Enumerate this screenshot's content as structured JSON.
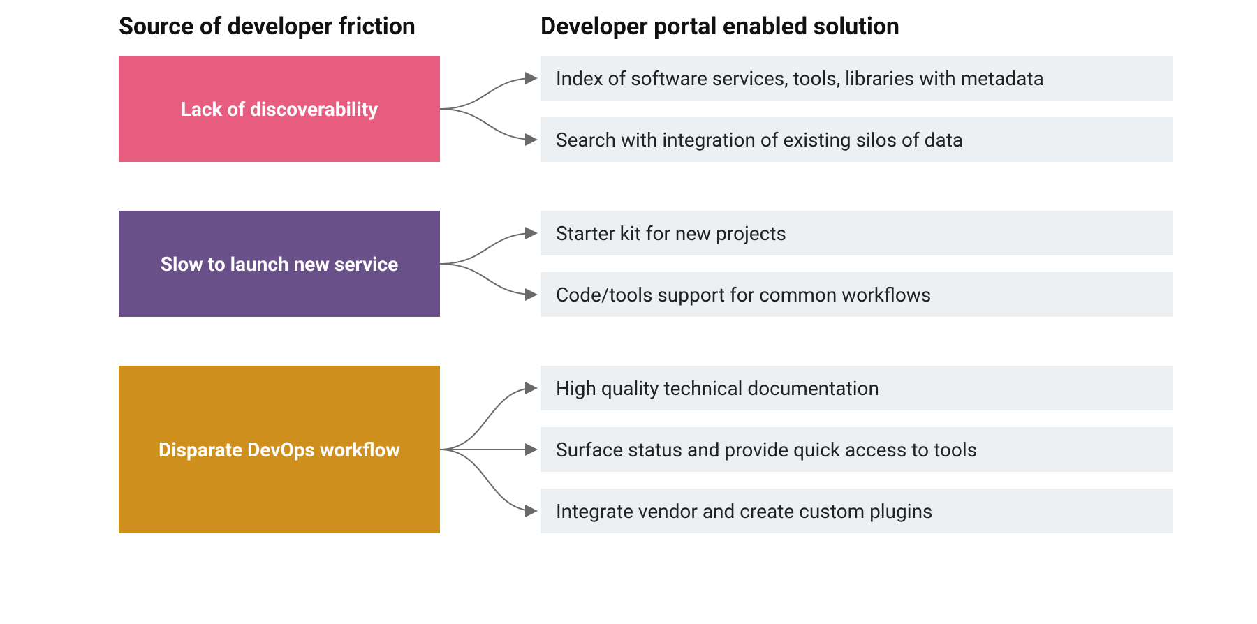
{
  "headers": {
    "left": "Source of developer friction",
    "right": "Developer portal enabled solution"
  },
  "groups": [
    {
      "source": "Lack of discoverability",
      "color": "#e75d7f",
      "solutions": [
        "Index of software services, tools, libraries with metadata",
        "Search with integration of existing silos of data"
      ]
    },
    {
      "source": "Slow to launch new service",
      "color": "#6a5089",
      "solutions": [
        "Starter kit for new projects",
        "Code/tools support for common workflows"
      ]
    },
    {
      "source": "Disparate DevOps workflow",
      "color": "#cf8f1d",
      "solutions": [
        "High quality technical documentation",
        "Surface status and provide quick access to tools",
        "Integrate vendor and create custom plugins"
      ]
    }
  ],
  "chart_data": {
    "type": "table",
    "title": "Developer friction sources mapped to developer portal solutions",
    "columns": [
      "Source of developer friction",
      "Developer portal enabled solution"
    ],
    "rows": [
      [
        "Lack of discoverability",
        "Index of software services, tools, libraries with metadata"
      ],
      [
        "Lack of discoverability",
        "Search with integration of existing silos of data"
      ],
      [
        "Slow to launch new service",
        "Starter kit for new projects"
      ],
      [
        "Slow to launch new service",
        "Code/tools support for common workflows"
      ],
      [
        "Disparate DevOps workflow",
        "High quality technical documentation"
      ],
      [
        "Disparate DevOps workflow",
        "Surface status and provide quick access to tools"
      ],
      [
        "Disparate DevOps workflow",
        "Integrate vendor and create custom plugins"
      ]
    ]
  }
}
